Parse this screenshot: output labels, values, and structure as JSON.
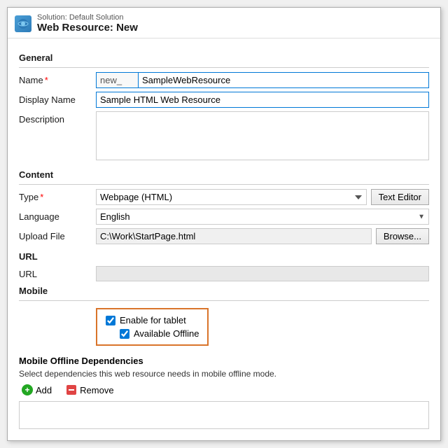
{
  "header": {
    "solution_label": "Solution: Default Solution",
    "page_title": "Web Resource: New"
  },
  "sections": {
    "general": {
      "label": "General",
      "name_prefix": "new_",
      "name_value": "SampleWebResource",
      "display_name_value": "Sample HTML Web Resource",
      "description_placeholder": ""
    },
    "content": {
      "label": "Content",
      "type_label": "Type",
      "type_value": "Webpage (HTML)",
      "text_editor_btn": "Text Editor",
      "language_label": "Language",
      "language_value": "English",
      "upload_file_label": "Upload File",
      "upload_path": "C:\\Work\\StartPage.html",
      "browse_btn": "Browse...",
      "url_label": "URL"
    },
    "mobile": {
      "label": "Mobile",
      "enable_tablet_label": "Enable for tablet",
      "available_offline_label": "Available Offline",
      "mobile_deps_header": "Mobile Offline Dependencies",
      "mobile_deps_desc": "Select dependencies this web resource needs in mobile offline mode.",
      "add_btn": "Add",
      "remove_btn": "Remove"
    }
  },
  "form_labels": {
    "name": "Name",
    "display_name": "Display Name",
    "description": "Description",
    "type": "Type",
    "language": "Language",
    "upload_file": "Upload File",
    "url": "URL"
  }
}
